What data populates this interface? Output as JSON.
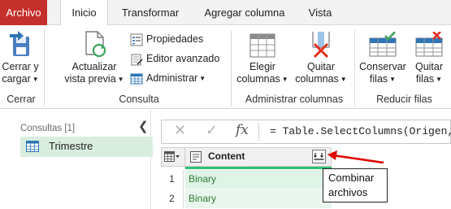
{
  "tabs": [
    {
      "label": "Archivo"
    },
    {
      "label": "Inicio"
    },
    {
      "label": "Transformar"
    },
    {
      "label": "Agregar columna"
    },
    {
      "label": "Vista"
    }
  ],
  "ribbon": {
    "close_apply": {
      "line1": "Cerrar y",
      "line2": "cargar"
    },
    "refresh": {
      "line1": "Actualizar",
      "line2": "vista previa"
    },
    "properties": "Propiedades",
    "advanced_editor": "Editor avanzado",
    "manage": "Administrar",
    "choose_columns": {
      "line1": "Elegir",
      "line2": "columnas"
    },
    "remove_columns": {
      "line1": "Quitar",
      "line2": "columnas"
    },
    "keep_rows": {
      "line1": "Conservar",
      "line2": "filas"
    },
    "remove_rows": {
      "line1": "Quitar",
      "line2": "filas"
    },
    "groups": {
      "close": "Cerrar",
      "query": "Consulta",
      "manage_columns": "Administrar columnas",
      "reduce_rows": "Reducir filas"
    }
  },
  "queries": {
    "title": "Consultas [1]",
    "items": [
      {
        "label": "Trimestre"
      }
    ]
  },
  "formula_bar": {
    "cancel_glyph": "✕",
    "confirm_glyph": "✓",
    "fx": "fx",
    "formula": "= Table.SelectColumns(Origen,{"
  },
  "grid": {
    "column": "Content",
    "rows": [
      {
        "num": "1",
        "value": "Binary"
      },
      {
        "num": "2",
        "value": "Binary"
      }
    ]
  },
  "callout": {
    "line1": "Combinar",
    "line2": "archivos"
  },
  "colors": {
    "file_tab": "#c4302b",
    "selection": "#d9eedf",
    "quality_bar": "#2fbf71",
    "annotation_arrow": "#e00000"
  }
}
